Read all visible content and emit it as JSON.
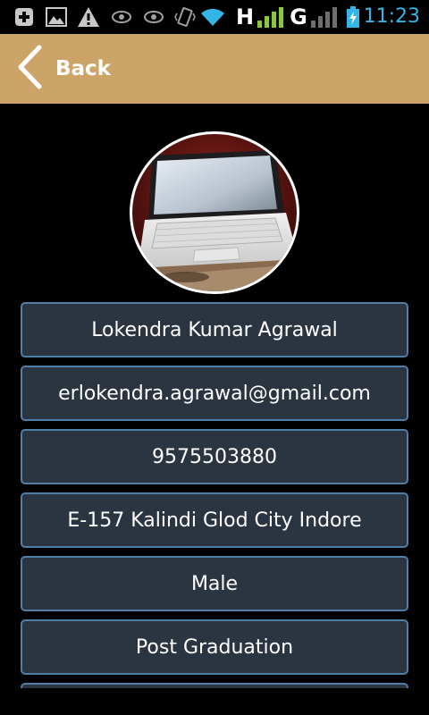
{
  "status_bar": {
    "time": "11:23",
    "network_label": "H",
    "network_label_2": "G",
    "colors": {
      "time": "#33b5e5",
      "signal": "#8cc63f",
      "icons": "#c8c8c8"
    },
    "icons": [
      "add-notification-icon",
      "image-icon",
      "warning-icon",
      "eye-icon",
      "eye-icon",
      "vibrate-icon",
      "wifi-icon",
      "signal-icon",
      "signal-icon",
      "battery-charging-icon"
    ]
  },
  "header": {
    "back_label": "Back",
    "color": "#cda468"
  },
  "profile": {
    "fields": [
      {
        "value": "Lokendra Kumar Agrawal"
      },
      {
        "value": "erlokendra.agrawal@gmail.com"
      },
      {
        "value": "9575503880"
      },
      {
        "value": "E-157 Kalindi Glod City Indore"
      },
      {
        "value": "Male"
      },
      {
        "value": "Post Graduation"
      }
    ]
  }
}
